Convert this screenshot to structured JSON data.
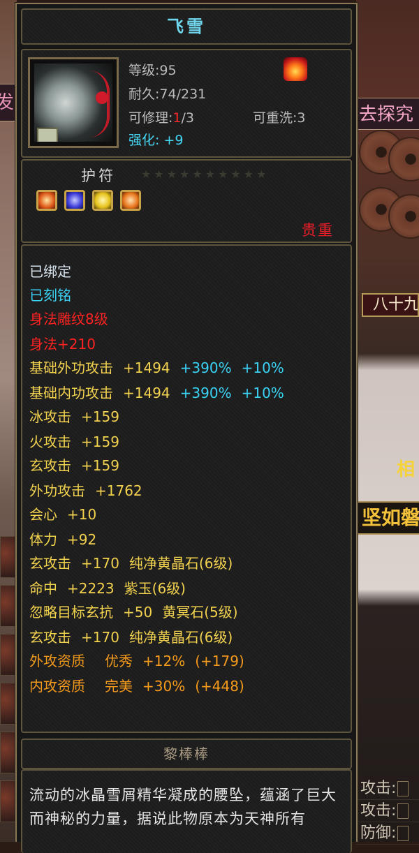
{
  "item": {
    "name": "飞雪",
    "level": "等级:95",
    "durability": "耐久:74/231",
    "repairable_label": "可修理:",
    "repairable_current": "1",
    "repairable_max": "/3",
    "rewashable": "可重洗:3",
    "enhance": "强化: +9",
    "icon": "jade-pendant-icon",
    "element_icon": "fire-element-icon"
  },
  "charm": {
    "label": "护符",
    "stars": "★★★★★★★★★★",
    "gems": [
      {
        "name": "sun-gem-icon",
        "color": "#e05a1a"
      },
      {
        "name": "blue-gem-icon",
        "color": "#3a3ad8"
      },
      {
        "name": "yellow-gem-icon",
        "color": "#e6c21a"
      },
      {
        "name": "orange-gem-icon",
        "color": "#e8741a"
      }
    ],
    "valuable": "贵重"
  },
  "attributes": {
    "bound": "已绑定",
    "engraved": "已刻铭",
    "carving": "身法雕纹8级",
    "agility": "身法+210",
    "base_ext": {
      "label": "基础外功攻击",
      "value": "+1494",
      "pct": "+390%",
      "extra": "+10%"
    },
    "base_int": {
      "label": "基础内功攻击",
      "value": "+1494",
      "pct": "+390%",
      "extra": "+10%"
    },
    "ice": {
      "label": "冰攻击",
      "value": "+159"
    },
    "fire": {
      "label": "火攻击",
      "value": "+159"
    },
    "xuan": {
      "label": "玄攻击",
      "value": "+159"
    },
    "ext_atk": {
      "label": "外功攻击",
      "value": "+1762"
    },
    "crit": {
      "label": "会心",
      "value": "+10"
    },
    "stamina": {
      "label": "体力",
      "value": "+92"
    },
    "gem1": {
      "label": "玄攻击",
      "value": "+170",
      "gem": "纯净黄晶石(6级)"
    },
    "gem2": {
      "label": "命中",
      "value": "+2223",
      "gem": "紫玉(6级)"
    },
    "gem3": {
      "label": "忽略目标玄抗",
      "value": "+50",
      "gem": "黄冥石(5级)"
    },
    "gem4": {
      "label": "玄攻击",
      "value": "+170",
      "gem": "纯净黄晶石(6级)"
    },
    "apt_ext": {
      "label": "外攻资质",
      "grade": "优秀",
      "pct": "+12%",
      "bonus": "(+179)"
    },
    "apt_int": {
      "label": "内攻资质",
      "grade": "完美",
      "pct": "+30%",
      "bonus": "(+448)"
    }
  },
  "author": "黎棒棒",
  "description": "流动的冰晶雪屑精华凝成的腰坠，蕴涵了巨大而神秘的力量，据说此物原本为天神所有",
  "background": {
    "left_tab": "发",
    "right_tab": "去探究",
    "right_banner": "八十九",
    "right_char": "相",
    "right_title": "坚如磐",
    "stat_rows": [
      "攻击:",
      "攻击:",
      "防御:"
    ]
  },
  "colors": {
    "title_cyan": "#6fd7ee",
    "red": "#ff2222",
    "yellow": "#f2d24e",
    "orange": "#f49a1c",
    "frame_gold": "#8c7a56"
  }
}
